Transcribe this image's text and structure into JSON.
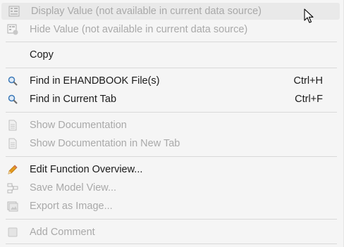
{
  "menu": {
    "items": [
      {
        "label": "Display Value (not available in current data source)",
        "shortcut": "",
        "icon": "value-table-icon",
        "enabled": false
      },
      {
        "label": "Hide Value (not available in current data source)",
        "shortcut": "",
        "icon": "value-table-hide-icon",
        "enabled": false
      },
      {
        "label": "Copy",
        "shortcut": "",
        "icon": "",
        "enabled": true
      },
      {
        "label": "Find in EHANDBOOK File(s)",
        "shortcut": "Ctrl+H",
        "icon": "search-icon",
        "enabled": true
      },
      {
        "label": "Find in Current Tab",
        "shortcut": "Ctrl+F",
        "icon": "search-icon",
        "enabled": true
      },
      {
        "label": "Show Documentation",
        "shortcut": "",
        "icon": "document-icon",
        "enabled": false
      },
      {
        "label": "Show Documentation in New Tab",
        "shortcut": "",
        "icon": "document-icon",
        "enabled": false
      },
      {
        "label": "Edit Function Overview...",
        "shortcut": "",
        "icon": "pencil-icon",
        "enabled": true
      },
      {
        "label": "Save Model View...",
        "shortcut": "",
        "icon": "model-view-icon",
        "enabled": false
      },
      {
        "label": "Export as Image...",
        "shortcut": "",
        "icon": "image-export-icon",
        "enabled": false
      },
      {
        "label": "Add Comment",
        "shortcut": "",
        "icon": "comment-icon",
        "enabled": false
      }
    ]
  },
  "colors": {
    "menu_background": "#f5f5f5",
    "hover_background": "#e9e9e9",
    "text_enabled": "#1b1b1b",
    "text_disabled": "#a9a9a9",
    "search_icon": "#3d7ab8",
    "pencil_icon": "#e39a1f"
  }
}
